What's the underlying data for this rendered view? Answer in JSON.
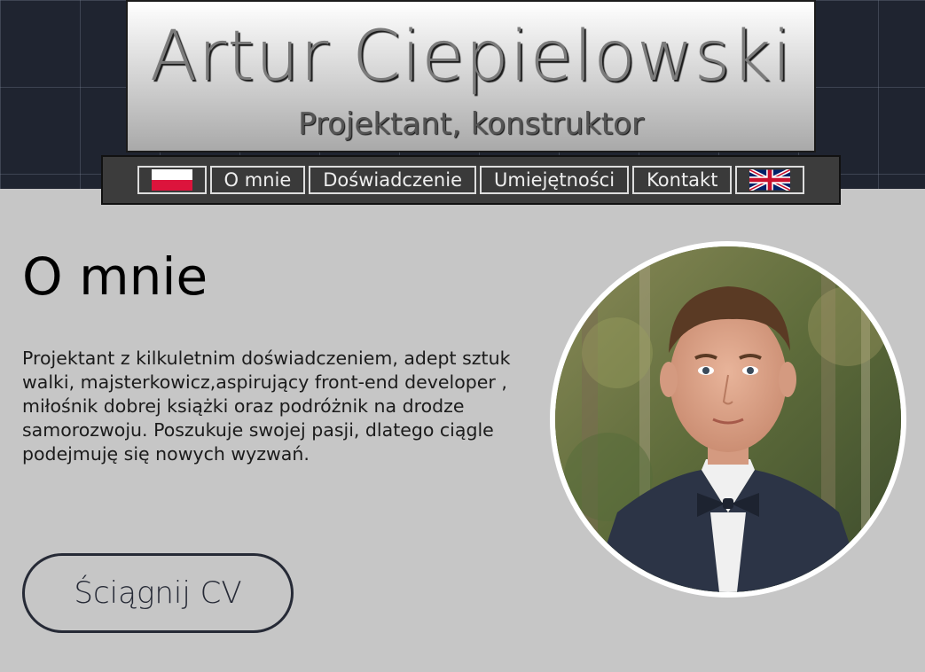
{
  "header": {
    "name": "Artur Ciepielowski",
    "subtitle": "Projektant, konstruktor"
  },
  "nav": {
    "flag_pl_icon": "polish-flag-icon",
    "items": [
      {
        "label": "O mnie"
      },
      {
        "label": "Doświadczenie"
      },
      {
        "label": "Umiejętności"
      },
      {
        "label": "Kontakt"
      }
    ],
    "flag_en_icon": "uk-flag-icon"
  },
  "about": {
    "title": "O mnie",
    "text": "Projektant z kilkuletnim doświadczeniem, adept sztuk walki, majsterkowicz,aspirujący front-end developer , miłośnik dobrej książki oraz podróżnik na drodze samorozwoju. Poszukuje swojej pasji, dlatego ciągle podejmuję się nowych wyzwań.",
    "cv_button": "Ściągnij CV"
  },
  "colors": {
    "background": "#c6c6c6",
    "header_band": "#1f2430",
    "nav_background": "#3c3c3c",
    "button_border": "#262a36"
  }
}
